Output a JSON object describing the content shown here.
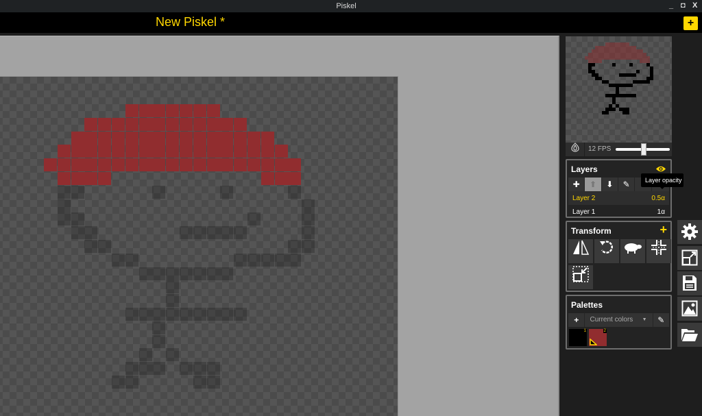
{
  "window": {
    "title": "Piskel",
    "controls": {
      "minimize": "_",
      "maximize": "◘",
      "close": "X"
    }
  },
  "header": {
    "document_title": "New Piskel *",
    "add_icon": "+"
  },
  "colors": {
    "accent": "#ffd700",
    "hat_red": "#912d2f",
    "outline_dark": "#000000",
    "panel_bg": "#232323"
  },
  "sprite": {
    "layers": [
      {
        "name": "Layer 1",
        "opacity": 1,
        "color": "#000000",
        "pixels": [
          [
            6,
            1
          ],
          [
            6,
            2
          ],
          [
            6,
            8
          ],
          [
            6,
            13
          ],
          [
            6,
            18
          ],
          [
            7,
            1
          ],
          [
            7,
            19
          ],
          [
            8,
            1
          ],
          [
            8,
            2
          ],
          [
            8,
            15
          ],
          [
            8,
            19
          ],
          [
            9,
            2
          ],
          [
            9,
            3
          ],
          [
            9,
            10
          ],
          [
            9,
            11
          ],
          [
            9,
            12
          ],
          [
            9,
            13
          ],
          [
            9,
            14
          ],
          [
            9,
            19
          ],
          [
            10,
            3
          ],
          [
            10,
            4
          ],
          [
            10,
            18
          ],
          [
            10,
            19
          ],
          [
            11,
            5
          ],
          [
            11,
            6
          ],
          [
            11,
            14
          ],
          [
            11,
            15
          ],
          [
            11,
            16
          ],
          [
            11,
            17
          ],
          [
            11,
            18
          ],
          [
            12,
            7
          ],
          [
            12,
            8
          ],
          [
            12,
            9
          ],
          [
            12,
            10
          ],
          [
            12,
            11
          ],
          [
            12,
            12
          ],
          [
            12,
            13
          ],
          [
            13,
            9
          ],
          [
            14,
            9
          ],
          [
            15,
            6
          ],
          [
            15,
            7
          ],
          [
            15,
            8
          ],
          [
            15,
            9
          ],
          [
            15,
            10
          ],
          [
            15,
            11
          ],
          [
            15,
            12
          ],
          [
            15,
            13
          ],
          [
            15,
            14
          ],
          [
            16,
            8
          ],
          [
            17,
            8
          ],
          [
            18,
            7
          ],
          [
            18,
            9
          ],
          [
            19,
            6
          ],
          [
            19,
            7
          ],
          [
            19,
            8
          ],
          [
            19,
            10
          ],
          [
            19,
            11
          ],
          [
            19,
            12
          ],
          [
            20,
            5
          ],
          [
            20,
            6
          ],
          [
            20,
            11
          ],
          [
            20,
            12
          ]
        ]
      },
      {
        "name": "Layer 2",
        "opacity": 0.5,
        "color": "#912d2f",
        "rows": [
          [
            0,
            6,
            12
          ],
          [
            1,
            3,
            14
          ],
          [
            2,
            2,
            16
          ],
          [
            3,
            1,
            17
          ],
          [
            4,
            0,
            18
          ],
          [
            5,
            1,
            4
          ],
          [
            5,
            16,
            18
          ]
        ]
      }
    ]
  },
  "preview": {
    "fps_label": "12 FPS",
    "fps_value": 12,
    "fps_slider_fraction": 0.52,
    "onion_icon": "onion-skin"
  },
  "layers_panel": {
    "title": "Layers",
    "visibility_icon": "eye",
    "toolbar": [
      "add-layer",
      "move-layer-up",
      "move-layer-down",
      "edit-layer",
      "merge-layer",
      "delete-layer"
    ],
    "tooltip": "Layer opacity",
    "items": [
      {
        "label": "Layer 2",
        "opacity": "0.5α",
        "selected": true
      },
      {
        "label": "Layer 1",
        "opacity": "1α",
        "selected": false
      }
    ]
  },
  "transform_panel": {
    "title": "Transform",
    "add_icon": "+",
    "tools": [
      "flip",
      "rotate",
      "clone-sheep",
      "center",
      "crop"
    ]
  },
  "palettes_panel": {
    "title": "Palettes",
    "add_icon": "+",
    "selected_palette": "Current colors",
    "colors": [
      {
        "index": "1",
        "hex": "#000000"
      },
      {
        "index": "2",
        "hex": "#912d2f"
      }
    ]
  },
  "side_tools": [
    "settings",
    "resize",
    "save",
    "export-image",
    "open"
  ]
}
